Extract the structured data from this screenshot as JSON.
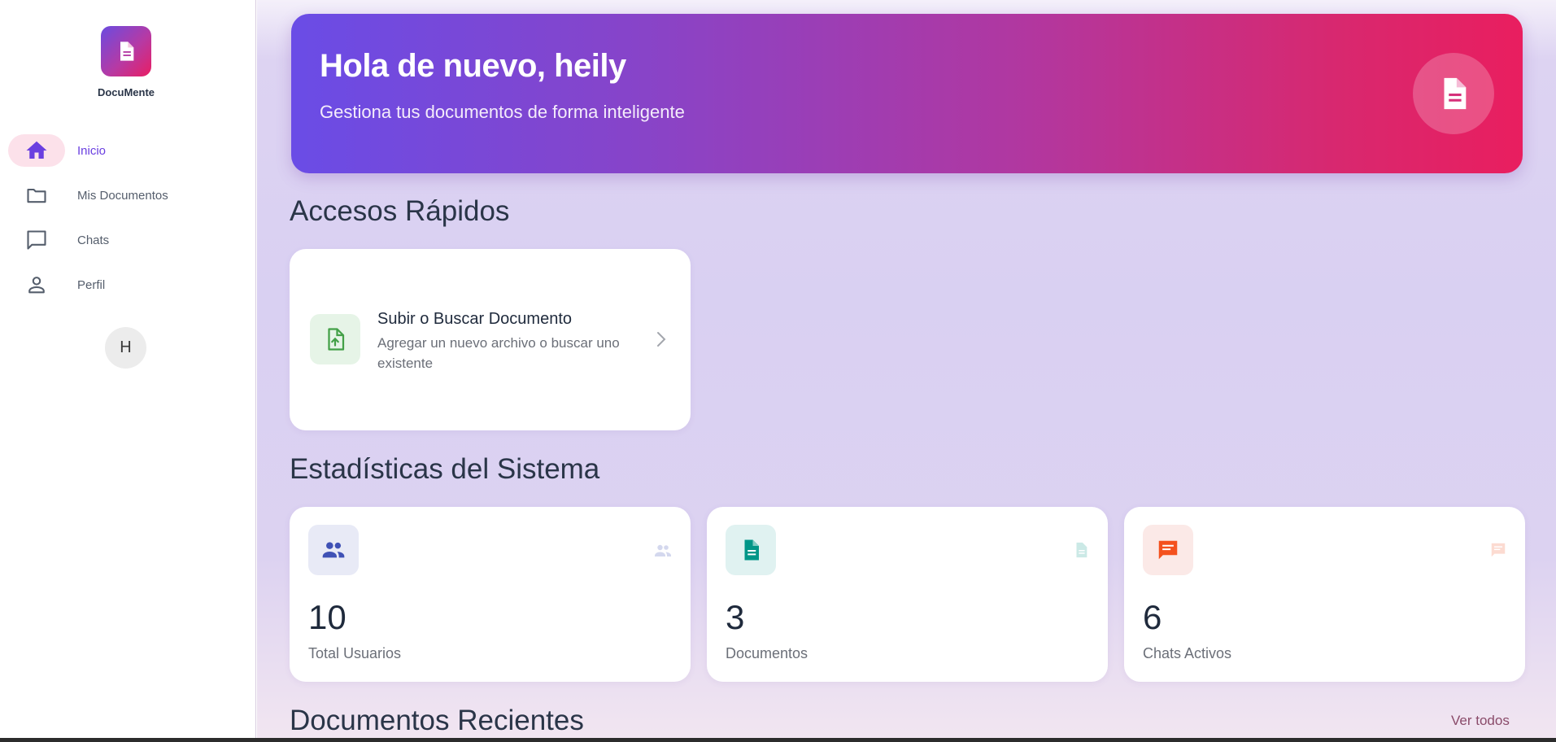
{
  "app": {
    "name": "DocuMente"
  },
  "sidebar": {
    "items": [
      {
        "label": "Inicio",
        "icon": "home-icon",
        "active": true
      },
      {
        "label": "Mis Documentos",
        "icon": "folder-icon",
        "active": false
      },
      {
        "label": "Chats",
        "icon": "chat-icon",
        "active": false
      },
      {
        "label": "Perfil",
        "icon": "person-icon",
        "active": false
      }
    ],
    "avatar_initial": "H"
  },
  "hero": {
    "title": "Hola de nuevo, heily",
    "subtitle": "Gestiona tus documentos de forma inteligente",
    "icon": "document-icon"
  },
  "quick_access": {
    "title": "Accesos Rápidos",
    "cards": [
      {
        "title": "Subir o Buscar Documento",
        "description": "Agregar un nuevo archivo o buscar uno existente",
        "icon": "file-upload-icon"
      }
    ]
  },
  "stats": {
    "title": "Estadísticas del Sistema",
    "cards": [
      {
        "value": "10",
        "label": "Total Usuarios",
        "icon": "users-icon",
        "color": "#3f51b5",
        "bg": "#e8eaf6"
      },
      {
        "value": "3",
        "label": "Documentos",
        "icon": "document-icon",
        "color": "#009688",
        "bg": "#e0f2f1"
      },
      {
        "value": "6",
        "label": "Chats Activos",
        "icon": "chat-icon",
        "color": "#f4511e",
        "bg": "#fbe9e7"
      }
    ]
  },
  "recent": {
    "title": "Documentos Recientes",
    "see_all": "Ver todos"
  },
  "colors": {
    "accent": "#6a3fe0",
    "brand_gradient_start": "#6a4ce6",
    "brand_gradient_end": "#e91e5f"
  }
}
